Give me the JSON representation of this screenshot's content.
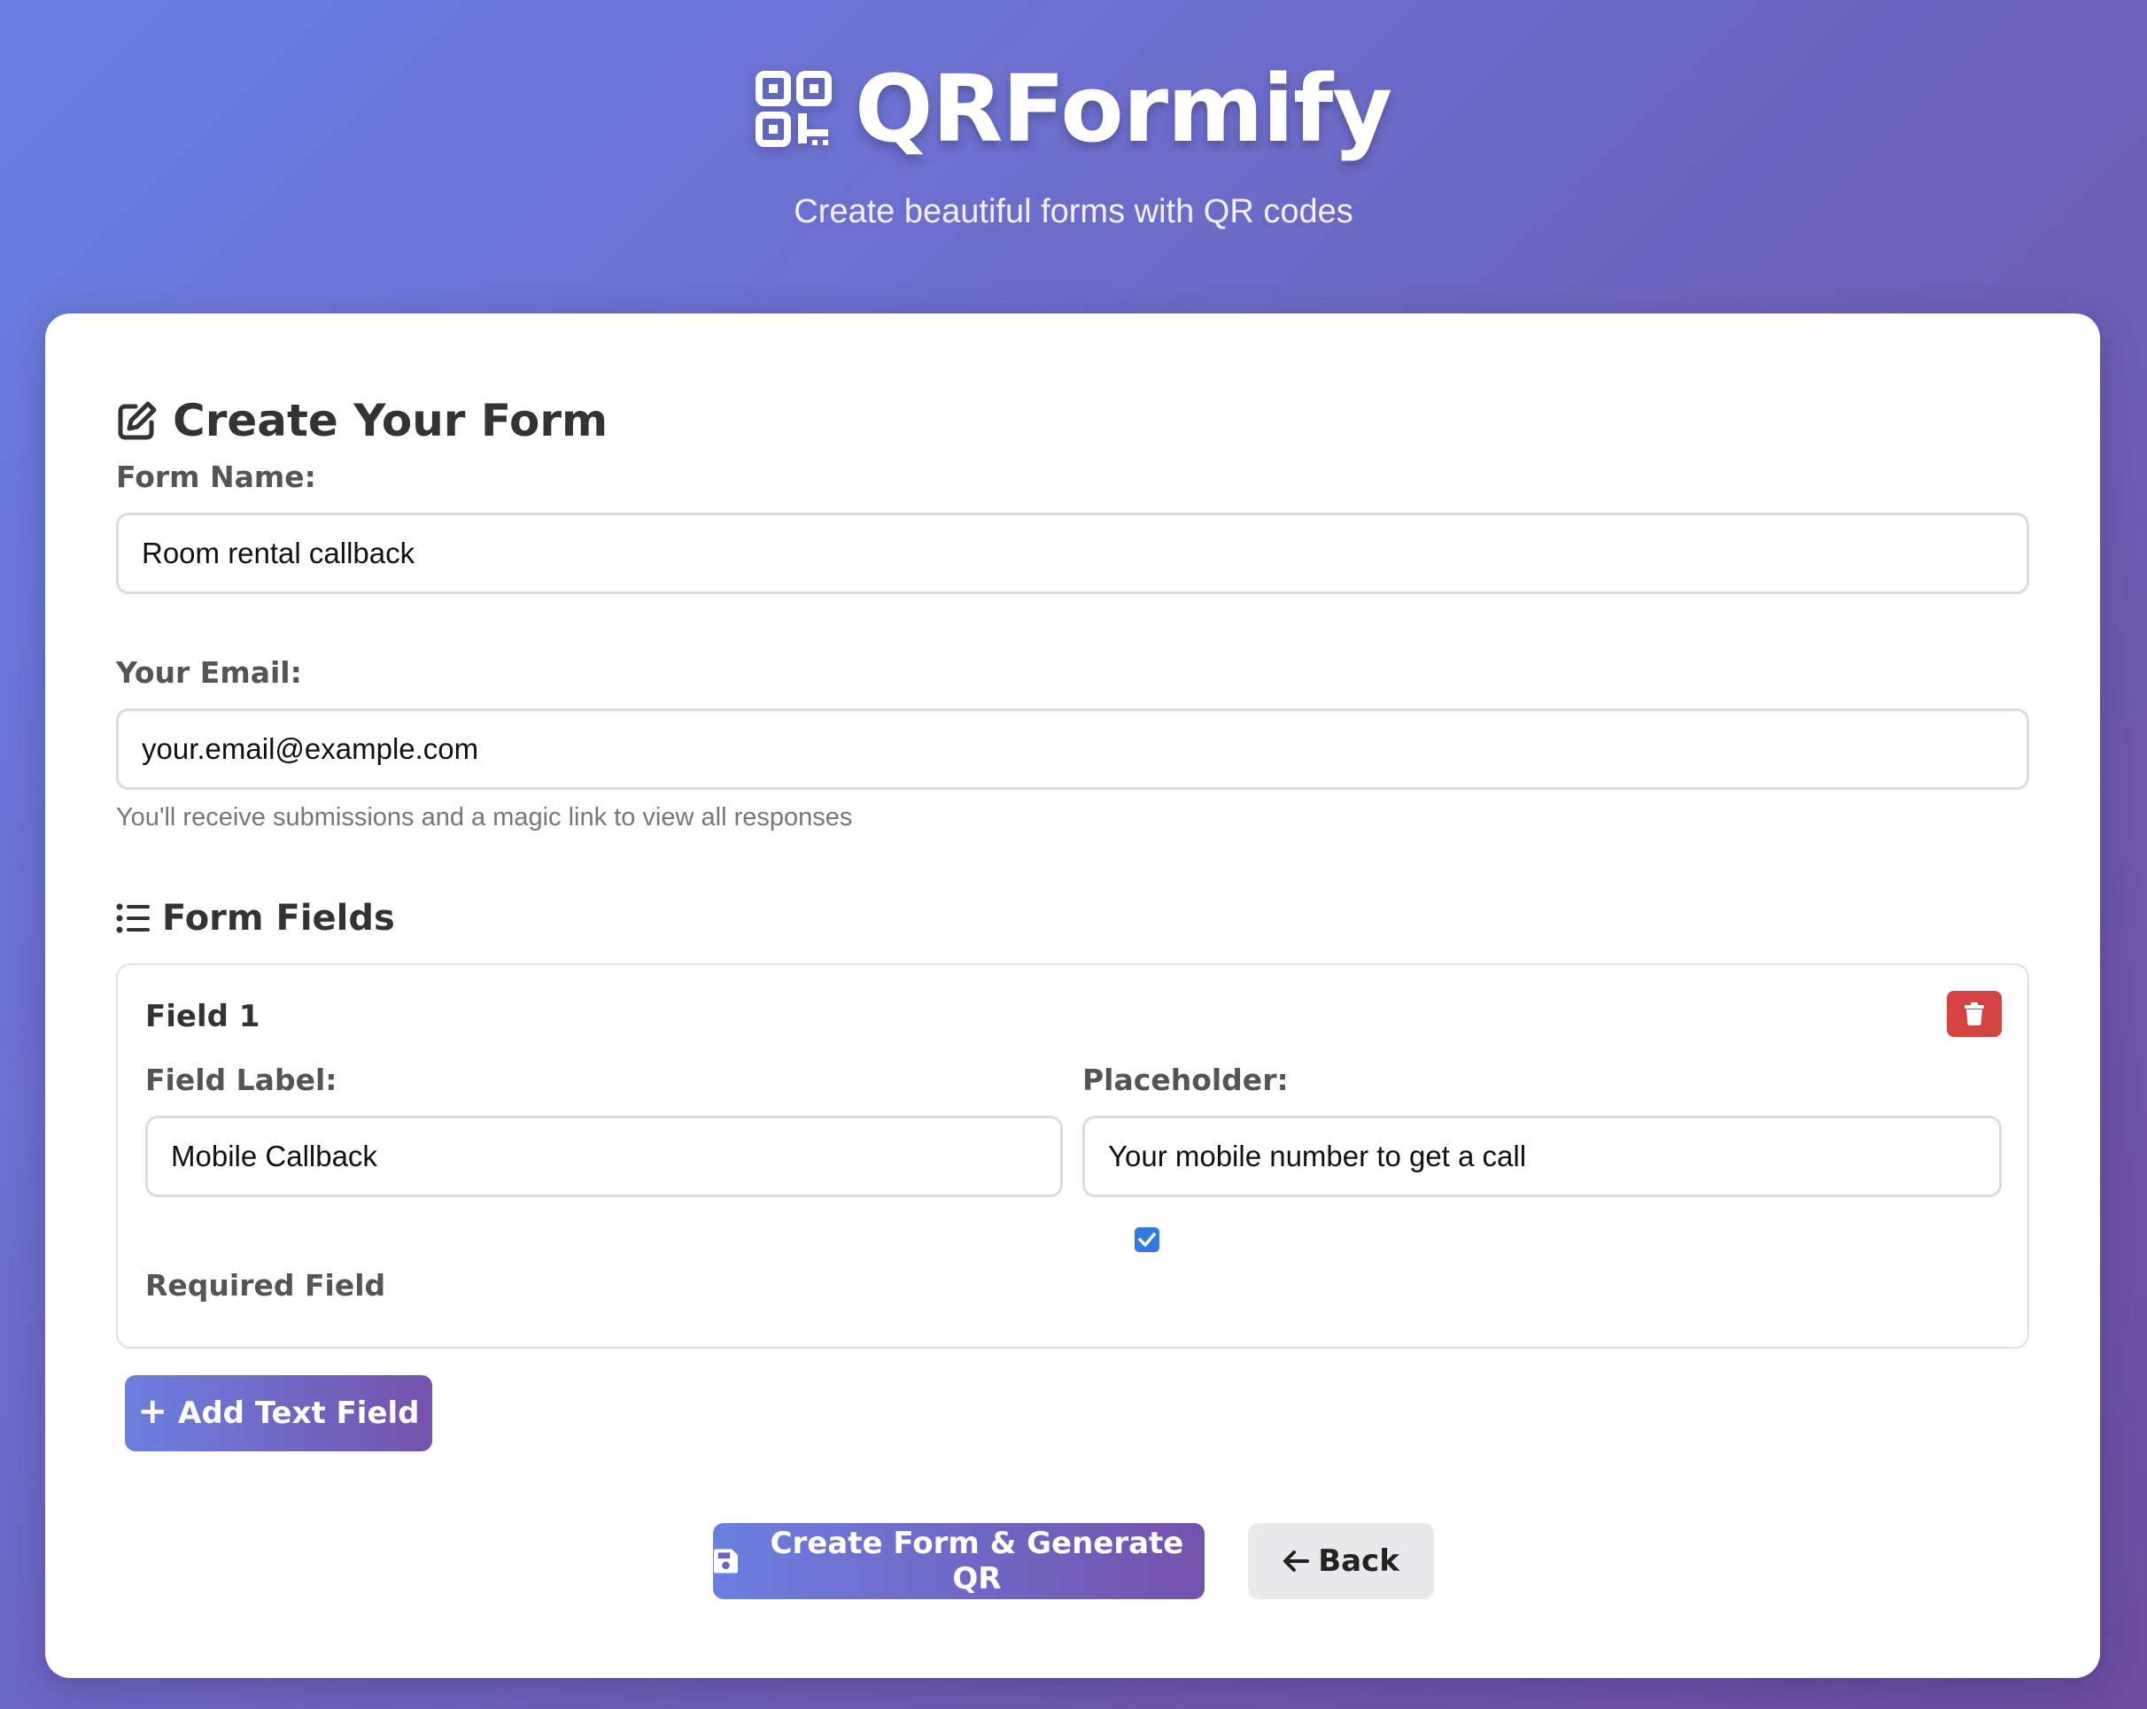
{
  "header": {
    "title": "QRFormify",
    "subtitle": "Create beautiful forms with QR codes",
    "logo_icon": "qrcode-icon"
  },
  "form": {
    "heading": "Create Your Form",
    "heading_icon": "edit-icon",
    "form_name_label": "Form Name:",
    "form_name_value": "Room rental callback",
    "email_label": "Your Email:",
    "email_value": "your.email@example.com",
    "email_hint": "You'll receive submissions and a magic link to view all responses"
  },
  "fields_section": {
    "heading": "Form Fields",
    "heading_icon": "list-icon",
    "fields": [
      {
        "title": "Field 1",
        "label_caption": "Field Label:",
        "label_value": "Mobile Callback",
        "placeholder_caption": "Placeholder:",
        "placeholder_value": "Your mobile number to get a call",
        "required_caption": "Required Field",
        "required": true,
        "delete_icon": "trash-icon"
      }
    ],
    "add_button_label": "Add Text Field"
  },
  "actions": {
    "create_label": "Create Form & Generate QR",
    "back_label": "Back"
  },
  "colors": {
    "accent_start": "#6b7fe0",
    "accent_end": "#7452ad",
    "danger": "#d64141",
    "checkbox": "#2f7be0"
  }
}
